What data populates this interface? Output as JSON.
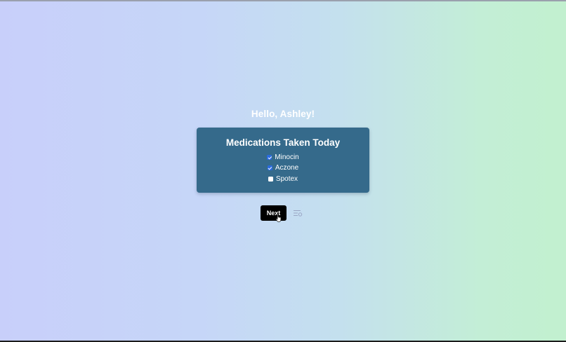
{
  "greeting": "Hello, Ashley!",
  "card": {
    "title": "Medications Taken Today",
    "medications": [
      {
        "label": "Minocin",
        "checked": true
      },
      {
        "label": "Aczone",
        "checked": true
      },
      {
        "label": "Spotex",
        "checked": false
      }
    ]
  },
  "actions": {
    "next_label": "Next",
    "settings_icon": "list-settings-icon"
  },
  "colors": {
    "card_bg": "#356a8b",
    "button_bg": "#000000",
    "checkbox_checked": "#2a6bde"
  }
}
